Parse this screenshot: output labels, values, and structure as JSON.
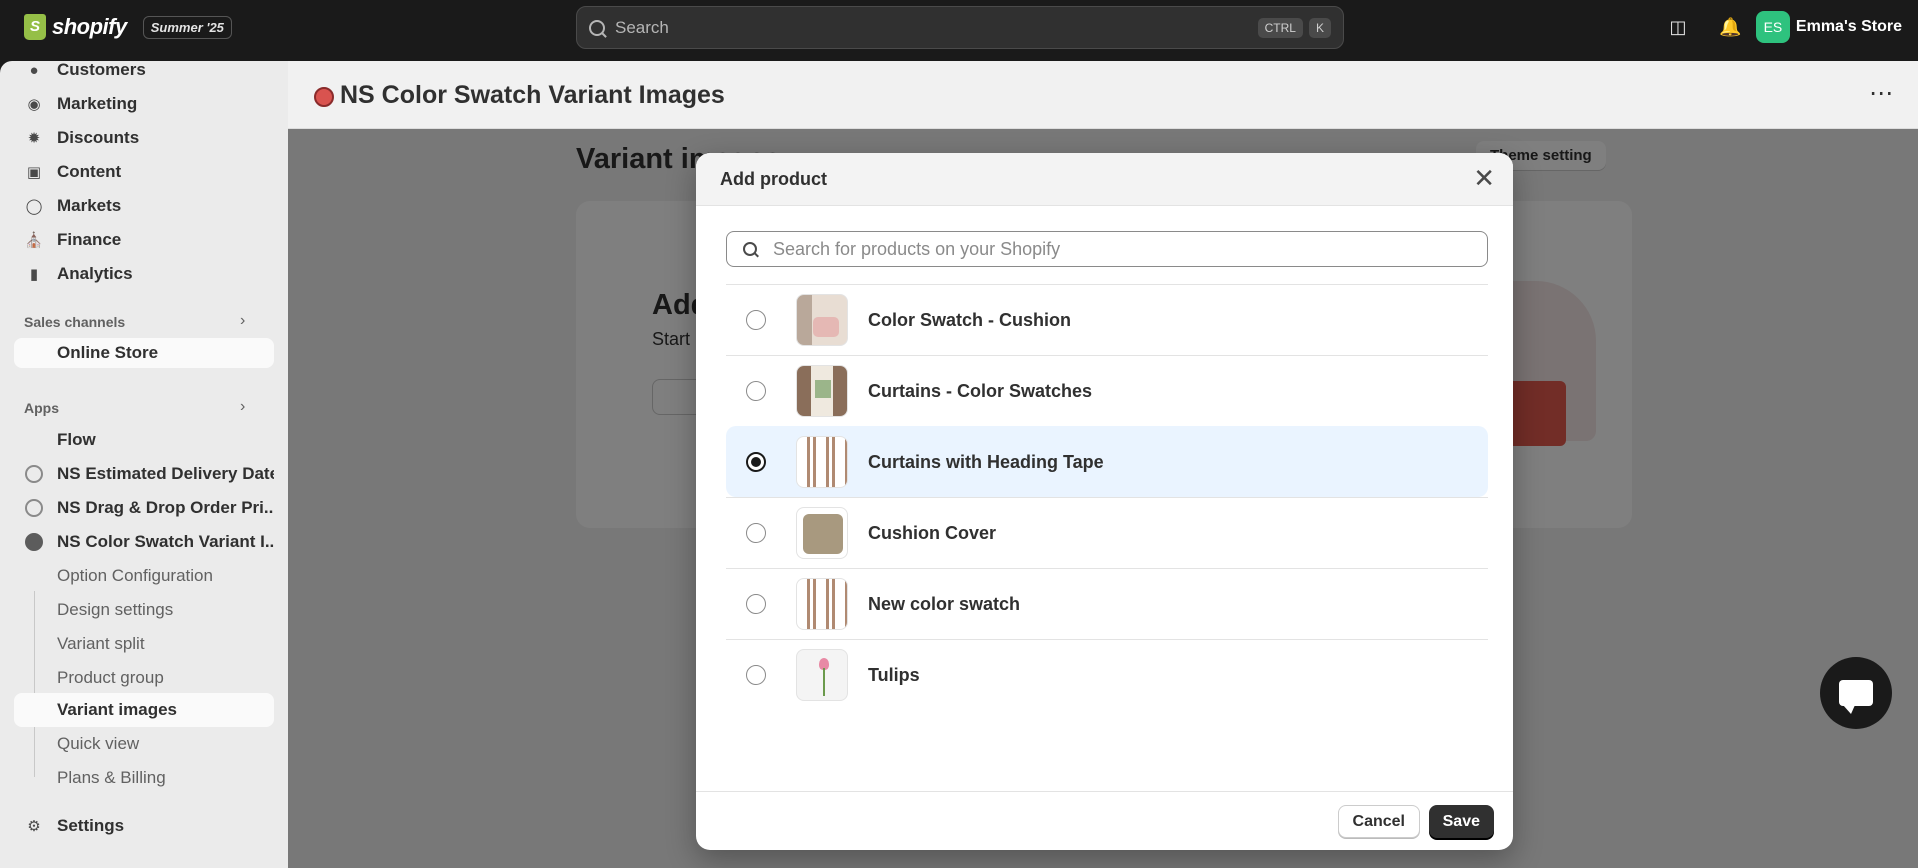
{
  "topbar": {
    "brand": "shopify",
    "edition": "Summer '25",
    "search_placeholder": "Search",
    "shortcut_ctrl": "CTRL",
    "shortcut_key": "K",
    "store_initials": "ES",
    "store_name": "Emma's Store"
  },
  "sidebar": {
    "items": [
      {
        "label": "Customers",
        "icon": "person-icon"
      },
      {
        "label": "Marketing",
        "icon": "target-icon"
      },
      {
        "label": "Discounts",
        "icon": "discount-icon"
      },
      {
        "label": "Content",
        "icon": "content-icon"
      },
      {
        "label": "Markets",
        "icon": "globe-icon"
      },
      {
        "label": "Finance",
        "icon": "bank-icon"
      },
      {
        "label": "Analytics",
        "icon": "chart-icon"
      }
    ],
    "sales_channels_label": "Sales channels",
    "online_store": "Online Store",
    "apps_label": "Apps",
    "apps": [
      {
        "label": "Flow"
      },
      {
        "label": "NS Estimated Delivery Date"
      },
      {
        "label": "NS Drag & Drop Order Pri..."
      },
      {
        "label": "NS Color Swatch Variant I..."
      }
    ],
    "sub_items": [
      {
        "label": "Option Configuration"
      },
      {
        "label": "Design settings"
      },
      {
        "label": "Variant split"
      },
      {
        "label": "Product group"
      },
      {
        "label": "Variant images"
      },
      {
        "label": "Quick view"
      },
      {
        "label": "Plans & Billing"
      }
    ],
    "settings": "Settings"
  },
  "app_header": {
    "title": "NS Color Swatch Variant Images"
  },
  "background": {
    "page_title": "Variant images",
    "theme_button": "Theme setting",
    "card_heading": "Add",
    "card_sub": "Start"
  },
  "modal": {
    "title": "Add product",
    "search_placeholder": "Search for products on your Shopify",
    "products": [
      {
        "name": "Color Swatch - Cushion",
        "selected": false
      },
      {
        "name": "Curtains - Color Swatches",
        "selected": false
      },
      {
        "name": "Curtains with Heading Tape",
        "selected": true
      },
      {
        "name": "Cushion Cover",
        "selected": false
      },
      {
        "name": "New color swatch",
        "selected": false
      },
      {
        "name": "Tulips",
        "selected": false
      }
    ],
    "cancel_label": "Cancel",
    "save_label": "Save"
  },
  "colors": {
    "topbar_bg": "#1a1a1a",
    "sidebar_bg": "#ebebeb",
    "selected_row": "#eaf4ff",
    "primary_button": "#303030",
    "brand_green": "#95bf47"
  }
}
